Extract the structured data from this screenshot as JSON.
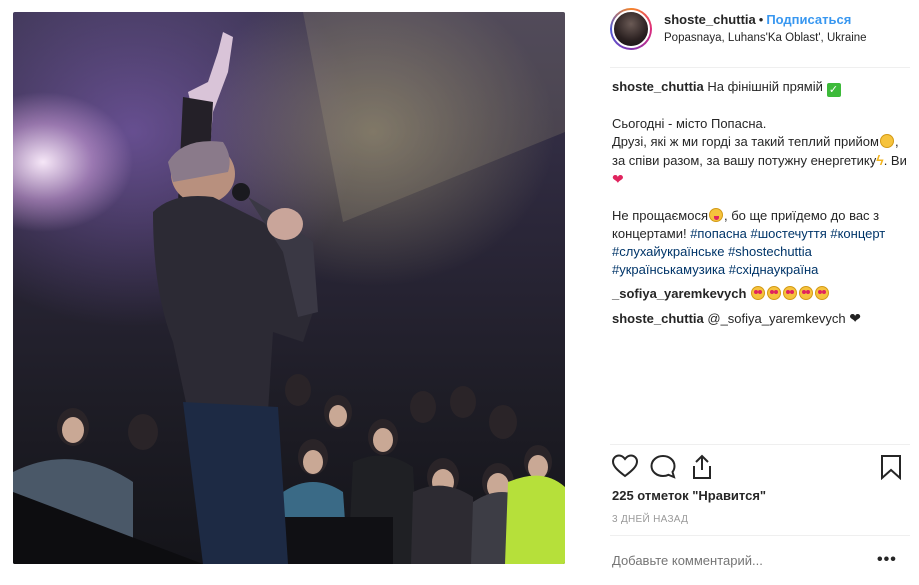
{
  "post": {
    "header": {
      "username": "shoste_chuttia",
      "separator": "•",
      "follow_label": "Подписаться",
      "location": "Popasnaya, Luhans'Ka Oblast', Ukraine"
    },
    "caption": {
      "username": "shoste_chuttia",
      "line1": "На фінішній прямій",
      "line2": "Сьогодні - місто Попасна.",
      "line3a": "Друзі, які ж ми горді за такий теплий прийом",
      "line3b": ", за співи разом, за вашу потужну енергетику",
      "line3c": ". Ви",
      "line4a": "Не прощаємося",
      "line4b": ", бо ще приїдемо до вас з концертами!",
      "hashtags": [
        "#попасна",
        "#шостечуття",
        "#концерт",
        "#слухайукраїнське",
        "#shostechuttia",
        "#українськамузика",
        "#східнаукраїна"
      ]
    },
    "comments": [
      {
        "username": "_sofiya_yaremkevych",
        "text": ""
      },
      {
        "username": "shoste_chuttia",
        "mention": "@_sofiya_yaremkevych"
      }
    ],
    "likes_text": "225 отметок \"Нравится\"",
    "timestamp": "3 ДНЕЙ НАЗАД",
    "add_comment_placeholder": "Добавьте комментарий...",
    "more_label": "•••"
  },
  "icons": {
    "like": "heart-outline-icon",
    "comment": "speech-bubble-icon",
    "share": "share-icon",
    "save": "bookmark-icon"
  },
  "colors": {
    "link": "#3897f0",
    "hashtag": "#003569",
    "muted": "#999999",
    "text": "#262626"
  }
}
